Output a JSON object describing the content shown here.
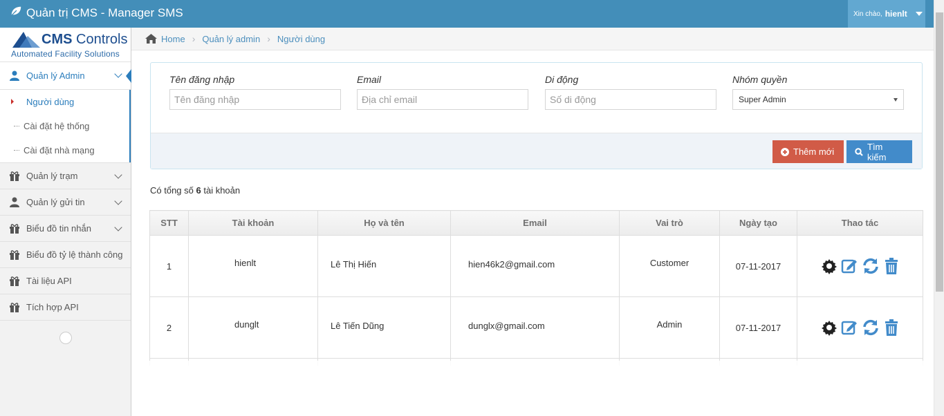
{
  "app": {
    "title": "Quản trị CMS - Manager SMS"
  },
  "user": {
    "greeting": "Xin chào,",
    "name": "hienlt"
  },
  "logo": {
    "brand_bold": "CMS",
    "brand_rest": " Controls",
    "tagline": "Automated Facility Solutions"
  },
  "sidebar": {
    "admin": {
      "label": "Quản lý Admin",
      "icon": "user-icon"
    },
    "submenu": [
      "Người dùng",
      "Cài đặt hệ thống",
      "Cài đặt nhà mạng"
    ],
    "items": [
      {
        "label": "Quản lý trạm",
        "icon": "gift-icon",
        "has_children": true
      },
      {
        "label": "Quản lý gửi tin",
        "icon": "user-icon",
        "has_children": true
      },
      {
        "label": "Biểu đồ tin nhắn",
        "icon": "gift-icon",
        "has_children": true
      },
      {
        "label": "Biểu đồ tỷ lệ thành công",
        "icon": "gift-icon",
        "has_children": false
      },
      {
        "label": "Tài liệu API",
        "icon": "gift-icon",
        "has_children": false
      },
      {
        "label": "Tích hợp API",
        "icon": "gift-icon",
        "has_children": false
      }
    ]
  },
  "breadcrumb": [
    "Home",
    "Quản lý admin",
    "Người dùng"
  ],
  "filters": {
    "username": {
      "label": "Tên đăng nhập",
      "placeholder": "Tên đăng nhập"
    },
    "email": {
      "label": "Email",
      "placeholder": "Địa chỉ email"
    },
    "phone": {
      "label": "Di động",
      "placeholder": "Số di động"
    },
    "group": {
      "label": "Nhóm quyền",
      "selected": "Super Admin"
    }
  },
  "buttons": {
    "add": "Thêm mới",
    "search": "Tìm kiếm"
  },
  "summary": {
    "prefix": "Có tổng số ",
    "count": "6",
    "suffix": " tài khoản"
  },
  "table": {
    "headers": [
      "STT",
      "Tài khoản",
      "Họ và tên",
      "Email",
      "Vai trò",
      "Ngày tạo",
      "Thao tác"
    ],
    "rows": [
      {
        "stt": "1",
        "account": "hienlt",
        "name": "Lê Thị Hiến",
        "email": "hien46k2@gmail.com",
        "role": "Customer",
        "created": "07-11-2017"
      },
      {
        "stt": "2",
        "account": "dunglt",
        "name": "Lê Tiến Dũng",
        "email": "dunglx@gmail.com",
        "role": "Admin",
        "created": "07-11-2017"
      }
    ]
  },
  "colors": {
    "topbar": "#438eb9",
    "accent": "#2b7dbc",
    "danger": "#d15b47",
    "primary": "#428bca"
  }
}
